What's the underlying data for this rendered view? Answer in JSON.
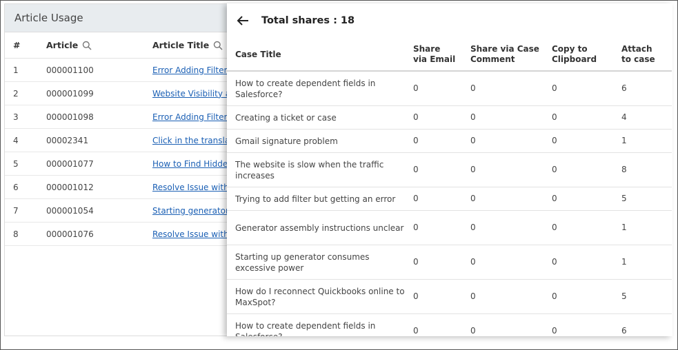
{
  "background": {
    "title": "Article Usage",
    "columns": {
      "num": "#",
      "article": "Article",
      "title": "Article Title"
    },
    "rows": [
      {
        "num": "1",
        "article": "000001100",
        "title": "Error Adding Filter"
      },
      {
        "num": "2",
        "article": "000001099",
        "title": "Website Visibility a"
      },
      {
        "num": "3",
        "article": "000001098",
        "title": "Error Adding Filter"
      },
      {
        "num": "4",
        "article": "00002341",
        "title": "Click in the transla"
      },
      {
        "num": "5",
        "article": "000001077",
        "title": "How to Find Hidde"
      },
      {
        "num": "6",
        "article": "000001012",
        "title": "Resolve Issue with"
      },
      {
        "num": "7",
        "article": "000001054",
        "title": "Starting generator"
      },
      {
        "num": "8",
        "article": "000001076",
        "title": "Resolve Issue with"
      }
    ]
  },
  "overlay": {
    "title": "Total shares : 18",
    "columns": {
      "case_title": "Case Title",
      "email_1": "Share",
      "email_2": "via Email",
      "comment_1": "Share via Case",
      "comment_2": "Comment",
      "clip_1": "Copy to",
      "clip_2": "Clipboard",
      "attach_1": "Attach",
      "attach_2": "to case"
    },
    "rows": [
      {
        "title": "How to create dependent fields in Salesforce?",
        "email": "0",
        "comment": "0",
        "clipboard": "0",
        "attach": "6"
      },
      {
        "title": "Creating a ticket or case",
        "email": "0",
        "comment": "0",
        "clipboard": "0",
        "attach": "4"
      },
      {
        "title": "Gmail signature problem",
        "email": "0",
        "comment": "0",
        "clipboard": "0",
        "attach": "1"
      },
      {
        "title": "The website is slow when the traffic increases",
        "email": "0",
        "comment": "0",
        "clipboard": "0",
        "attach": "8"
      },
      {
        "title": "Trying to add filter but getting an error",
        "email": "0",
        "comment": "0",
        "clipboard": "0",
        "attach": "5"
      },
      {
        "title": "Generator assembly instructions unclear",
        "email": "0",
        "comment": "0",
        "clipboard": "0",
        "attach": "1"
      },
      {
        "title": "Starting up generator consumes excessive power",
        "email": "0",
        "comment": "0",
        "clipboard": "0",
        "attach": "1"
      },
      {
        "title": "How do I reconnect Quickbooks online to MaxSpot?",
        "email": "0",
        "comment": "0",
        "clipboard": "0",
        "attach": "5"
      },
      {
        "title": "How to create dependent fields in Salesforce?",
        "email": "0",
        "comment": "0",
        "clipboard": "0",
        "attach": "6"
      }
    ]
  },
  "icons": {
    "back": "arrow-left-icon",
    "search": "search-icon"
  }
}
